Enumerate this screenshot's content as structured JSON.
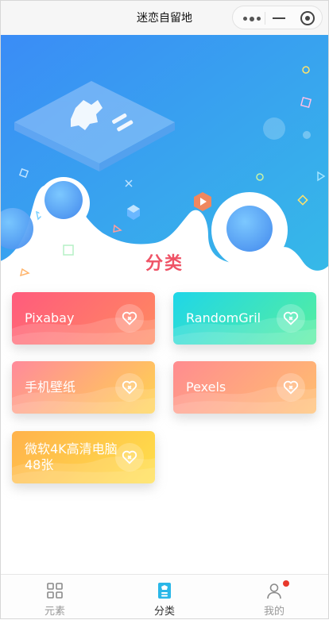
{
  "nav": {
    "title": "迷恋自留地"
  },
  "section": {
    "title": "分类"
  },
  "categories": [
    {
      "label": "Pixabay",
      "icon": "heart-link-icon"
    },
    {
      "label": "RandomGril",
      "icon": "heart-link-icon"
    },
    {
      "label": "手机壁纸",
      "icon": "heart-link-icon"
    },
    {
      "label": "Pexels",
      "icon": "heart-link-icon"
    },
    {
      "label": "微软4K高清电脑48张",
      "icon": "heart-link-icon"
    }
  ],
  "tabbar": [
    {
      "label": "元素",
      "icon": "grid-icon"
    },
    {
      "label": "分类",
      "icon": "category-icon"
    },
    {
      "label": "我的",
      "icon": "user-icon"
    }
  ],
  "colors": {
    "accent": "#ef5366",
    "hero_start": "#3f8ef7",
    "hero_end": "#3bb6ea"
  }
}
